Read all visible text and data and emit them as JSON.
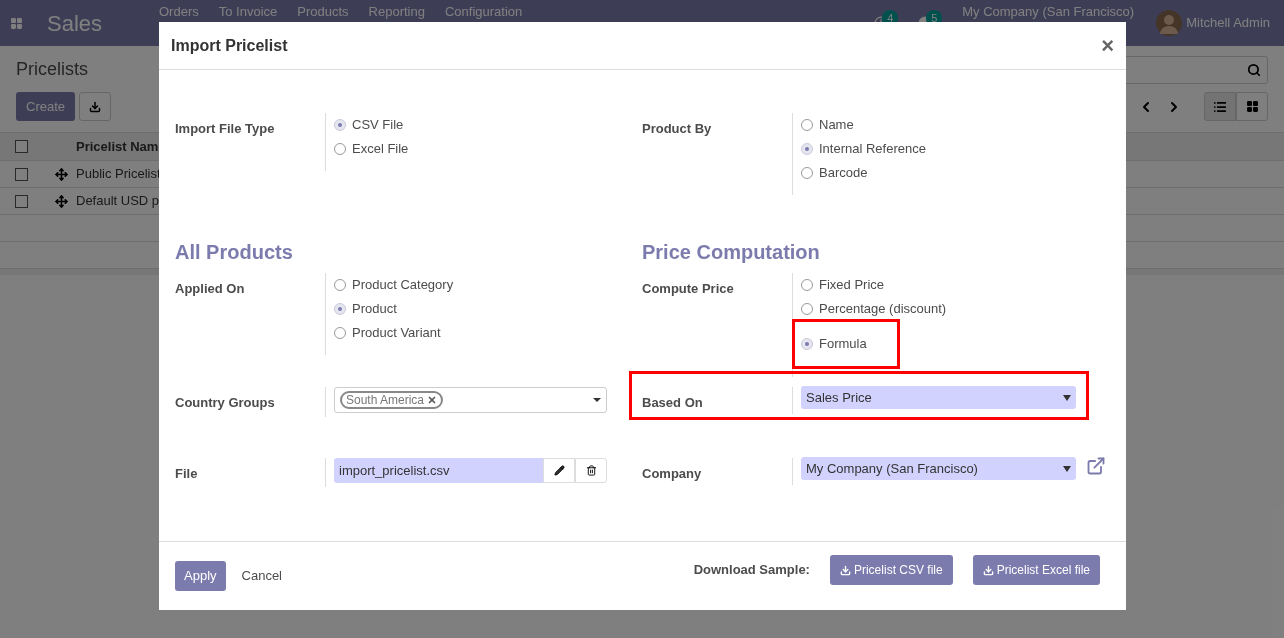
{
  "navbar": {
    "app": "Sales",
    "menu": [
      "Orders",
      "To Invoice",
      "Products",
      "Reporting",
      "Configuration"
    ],
    "activity_count": "4",
    "message_count": "5",
    "company": "My Company (San Francisco)",
    "user": "Mitchell Admin"
  },
  "control_panel": {
    "title": "Pricelists",
    "create_label": "Create"
  },
  "list": {
    "column": "Pricelist Nam",
    "all_checked": false,
    "rows": [
      {
        "name": "Public Pricelist",
        "checked": false
      },
      {
        "name": "Default USD p",
        "checked": false
      }
    ]
  },
  "dialog": {
    "title": "Import Pricelist",
    "close": "×",
    "rows": [
      {
        "left": {
          "kind": "radio",
          "label": "Import File Type",
          "options": [
            {
              "label": "CSV File",
              "selected": true,
              "highlighted": false
            },
            {
              "label": "Excel File",
              "selected": false,
              "highlighted": false
            }
          ]
        },
        "right": {
          "kind": "radio",
          "label": "Product By",
          "options": [
            {
              "label": "Name",
              "selected": false,
              "highlighted": false
            },
            {
              "label": "Internal Reference",
              "selected": true,
              "highlighted": false
            },
            {
              "label": "Barcode",
              "selected": false,
              "highlighted": false
            }
          ]
        }
      },
      {
        "left": {
          "kind": "heading",
          "text": "All Products"
        },
        "right": {
          "kind": "heading",
          "text": "Price Computation"
        }
      },
      {
        "left": {
          "kind": "radio",
          "label": "Applied On",
          "options": [
            {
              "label": "Product Category",
              "selected": false,
              "highlighted": false
            },
            {
              "label": "Product",
              "selected": true,
              "highlighted": false
            },
            {
              "label": "Product Variant",
              "selected": false,
              "highlighted": false
            }
          ]
        },
        "right": {
          "kind": "radio",
          "label": "Compute Price",
          "options": [
            {
              "label": "Fixed Price",
              "selected": false,
              "highlighted": false
            },
            {
              "label": "Percentage (discount)",
              "selected": false,
              "highlighted": false
            },
            {
              "label": "Formula",
              "selected": true,
              "highlighted": true
            }
          ]
        }
      },
      {
        "left": {
          "kind": "tags",
          "label": "Country Groups",
          "tags": [
            "South America"
          ]
        },
        "right": {
          "kind": "select",
          "label": "Based On",
          "value": "Sales Price",
          "highlighted": true,
          "external_link": false
        }
      },
      {
        "left": {
          "kind": "file",
          "label": "File",
          "value": "import_pricelist.csv"
        },
        "right": {
          "kind": "select",
          "label": "Company",
          "value": "My Company (San Francisco)",
          "highlighted": false,
          "external_link": true
        }
      }
    ],
    "apply": "Apply",
    "cancel": "Cancel",
    "download_label": "Download Sample:",
    "downloads": [
      "Pricelist CSV file",
      "Pricelist Excel file"
    ]
  }
}
